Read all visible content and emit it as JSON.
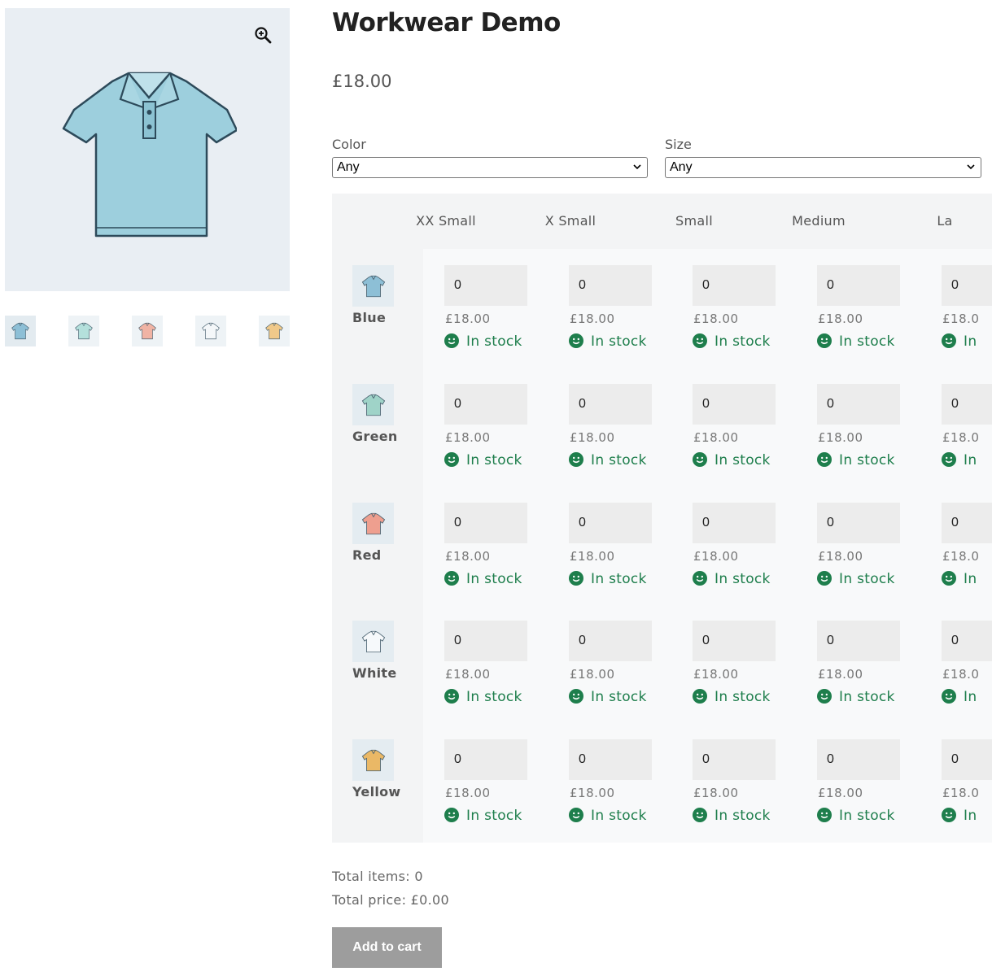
{
  "product": {
    "title": "Workwear Demo",
    "price": "£18.00"
  },
  "gallery": {
    "main_color": "#9dcfdd",
    "zoom_icon": "zoom-in-icon",
    "thumbnails": [
      {
        "name": "Blue",
        "color": "#8dbfd6"
      },
      {
        "name": "Green",
        "color": "#b4e0dc"
      },
      {
        "name": "Red",
        "color": "#f0b3a4"
      },
      {
        "name": "White",
        "color": "#f4f7f9"
      },
      {
        "name": "Yellow",
        "color": "#f0c98a"
      }
    ]
  },
  "filters": {
    "color": {
      "label": "Color",
      "selected": "Any"
    },
    "size": {
      "label": "Size",
      "selected": "Any"
    }
  },
  "matrix": {
    "columns": [
      "XX Small",
      "X Small",
      "Small",
      "Medium",
      "La"
    ],
    "rows": [
      {
        "label": "Blue",
        "color": "#8dbfd6"
      },
      {
        "label": "Green",
        "color": "#9fd3c8"
      },
      {
        "label": "Red",
        "color": "#ee9f8f"
      },
      {
        "label": "White",
        "color": "#f6f9fb"
      },
      {
        "label": "Yellow",
        "color": "#eab866"
      }
    ],
    "cell": {
      "quantity": "0",
      "price": "£18.00",
      "price_clipped": "£18.0",
      "stock": "In stock",
      "stock_clipped": "In",
      "stock_color": "#1e7e4c"
    }
  },
  "totals": {
    "items": "Total items: 0",
    "price": "Total price: £0.00"
  },
  "cart": {
    "button_label": "Add to cart"
  }
}
